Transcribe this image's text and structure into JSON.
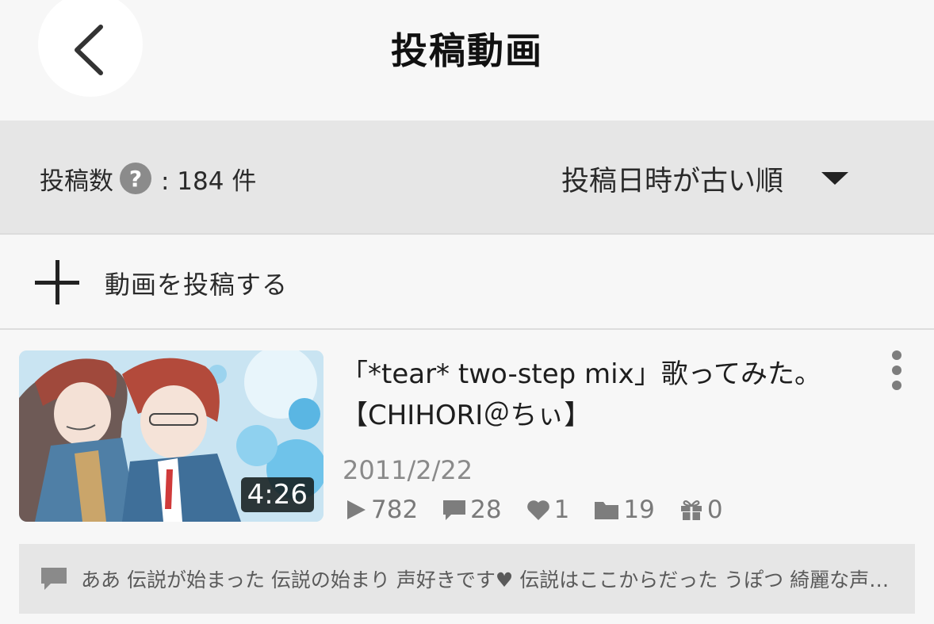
{
  "header": {
    "title": "投稿動画",
    "back_icon": "chevron-left-icon"
  },
  "sortbar": {
    "count_label": "投稿数",
    "help_icon": "?",
    "count_value": ": 184 件",
    "sort_selected": "投稿日時が古い順"
  },
  "add_video": {
    "label": "動画を投稿する",
    "icon": "plus-icon"
  },
  "videos": [
    {
      "title": "「*tear* two-step mix」歌ってみた。【CHIHORI＠ちぃ】",
      "duration": "4:26",
      "date": "2011/2/22",
      "views": "782",
      "comments": "28",
      "likes": "1",
      "mylists": "19",
      "gifts": "0",
      "latest_comments": "ああ 伝説が始まった 伝説の始まり 声好きです♥ 伝説はここからだった うぽつ 綺麗な声だなぁ"
    }
  ],
  "colors": {
    "background": "#f7f7f7",
    "bar": "#e6e6e6",
    "text": "#252525",
    "muted": "#8a8a8a"
  }
}
